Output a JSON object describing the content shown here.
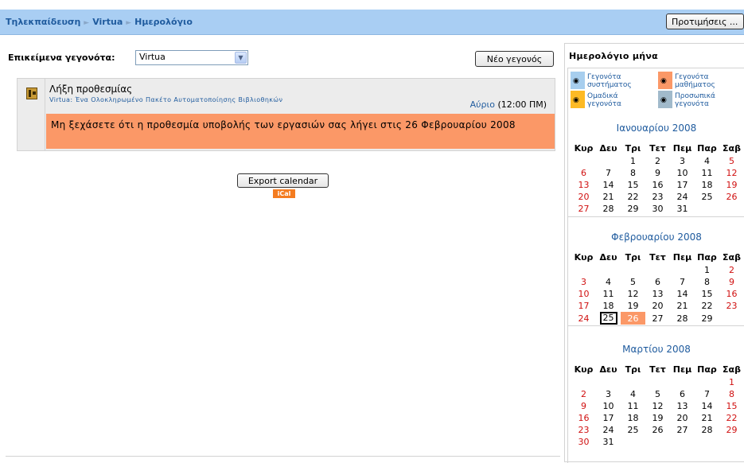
{
  "header": {
    "breadcrumb": [
      "Τηλεκπαίδευση",
      "Virtua",
      "Ημερολόγιο"
    ],
    "breadcrumb_separator": "►",
    "preferences_label": "Προτιμήσεις ..."
  },
  "main": {
    "filter_label": "Επικείμενα γεγονότα:",
    "filter_value": "Virtua",
    "new_event_label": "Νέο γεγονός",
    "event": {
      "title": "Λήξη προθεσμίας",
      "course": "Virtua: Ένα Ολοκληρωμένο Πακέτο Αυτοματοποίησης Βιβλιοθηκών",
      "time_link": "Αύριο",
      "time_value": "(12:00 ΠΜ)",
      "description": "Μη ξεχάσετε ότι η προθεσμία υποβολής των εργασιών σας λήγει στις 26 Φεβρουαρίου 2008"
    },
    "export_label": "Export calendar",
    "ical_label": "iCal"
  },
  "sidebar": {
    "title": "Ημερολόγιο μήνα",
    "legend": [
      {
        "label_line1": "Γεγονότα",
        "label_line2": "συστήματος",
        "color": "#a7ceee"
      },
      {
        "label_line1": "Γεγονότα",
        "label_line2": "μαθήματος",
        "color": "#fb9867"
      },
      {
        "label_line1": "Ομαδικά",
        "label_line2": "γεγονότα",
        "color": "#fdba25"
      },
      {
        "label_line1": "Προσωπικά",
        "label_line2": "γεγονότα",
        "color": "#a1bacb"
      }
    ],
    "weekdays": [
      "Κυρ",
      "Δευ",
      "Τρι",
      "Τετ",
      "Πεμ",
      "Παρ",
      "Σαβ"
    ],
    "months": [
      {
        "title": "Ιανουαρίου 2008",
        "weeks": [
          [
            "",
            "",
            "1",
            "2",
            "3",
            "4",
            "5"
          ],
          [
            "6",
            "7",
            "8",
            "9",
            "10",
            "11",
            "12"
          ],
          [
            "13",
            "14",
            "15",
            "16",
            "17",
            "18",
            "19"
          ],
          [
            "20",
            "21",
            "22",
            "23",
            "24",
            "25",
            "26"
          ],
          [
            "27",
            "28",
            "29",
            "30",
            "31",
            "",
            ""
          ]
        ]
      },
      {
        "title": "Φεβρουαρίου 2008",
        "weeks": [
          [
            "",
            "",
            "",
            "",
            "",
            "1",
            "2"
          ],
          [
            "3",
            "4",
            "5",
            "6",
            "7",
            "8",
            "9"
          ],
          [
            "10",
            "11",
            "12",
            "13",
            "14",
            "15",
            "16"
          ],
          [
            "17",
            "18",
            "19",
            "20",
            "21",
            "22",
            "23"
          ],
          [
            "24",
            "25",
            "26",
            "27",
            "28",
            "29",
            ""
          ]
        ],
        "today": "25",
        "course_event_day": "26"
      },
      {
        "title": "Μαρτίου 2008",
        "weeks": [
          [
            "",
            "",
            "",
            "",
            "",
            "",
            "1"
          ],
          [
            "2",
            "3",
            "4",
            "5",
            "6",
            "7",
            "8"
          ],
          [
            "9",
            "10",
            "11",
            "12",
            "13",
            "14",
            "15"
          ],
          [
            "16",
            "17",
            "18",
            "19",
            "20",
            "21",
            "22"
          ],
          [
            "23",
            "24",
            "25",
            "26",
            "27",
            "28",
            "29"
          ],
          [
            "30",
            "31",
            "",
            "",
            "",
            "",
            ""
          ]
        ]
      }
    ]
  }
}
